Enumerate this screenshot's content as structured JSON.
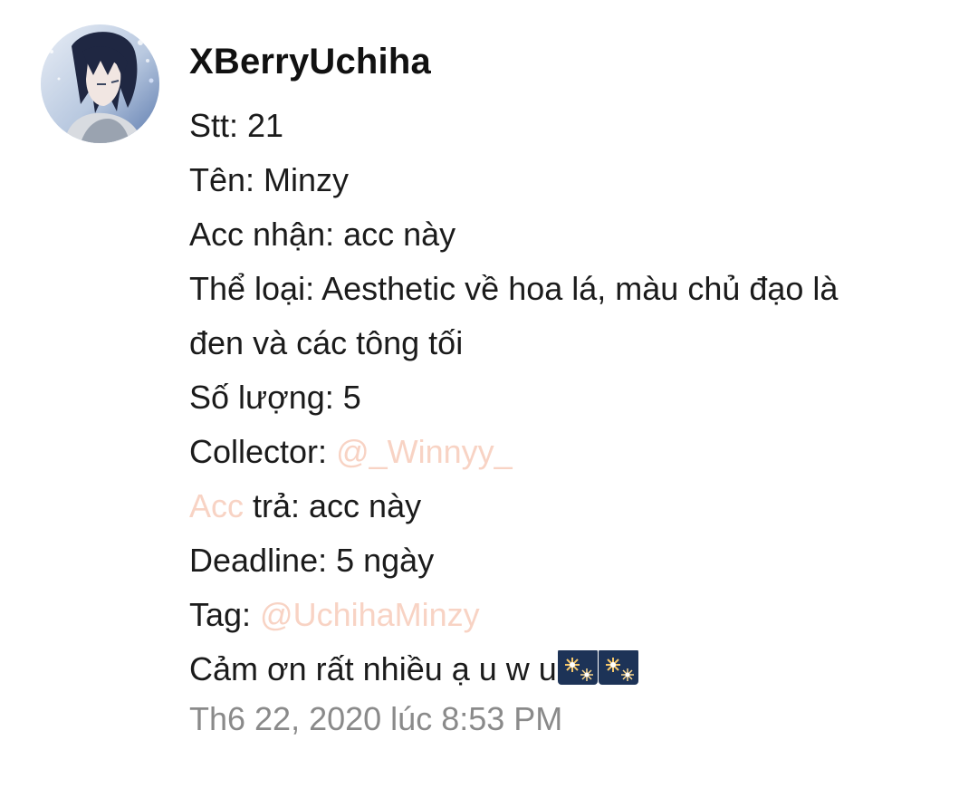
{
  "post": {
    "username": "XBerryUchiha",
    "lines": {
      "stt": "Stt: 21",
      "ten": "Tên: Minzy",
      "acc_nhan": "Acc nhận: acc này",
      "the_loai_1": "Thể loại: Aesthetic về hoa lá, màu chủ đạo là",
      "the_loai_2": "đen và các tông tối",
      "so_luong": "Số lượng: 5",
      "collector_label": "Collector: ",
      "collector_mention": "@_Winnyy_",
      "acc_tra_highlight": "Acc",
      "acc_tra_rest": " trả: acc này",
      "deadline": "Deadline: 5 ngày",
      "tag_label": "Tag: ",
      "tag_mention": "@UchihaMinzy",
      "thanks": "Cảm ơn rất nhiều ạ u w u"
    },
    "emojis": [
      "fireworks-emoji",
      "fireworks-emoji"
    ],
    "timestamp": "Th6 22, 2020 lúc 8:53 PM"
  },
  "colors": {
    "mention": "#f8d3c4",
    "text": "#1b1b1b",
    "timestamp": "#8a8a8a",
    "background": "#ffffff"
  }
}
